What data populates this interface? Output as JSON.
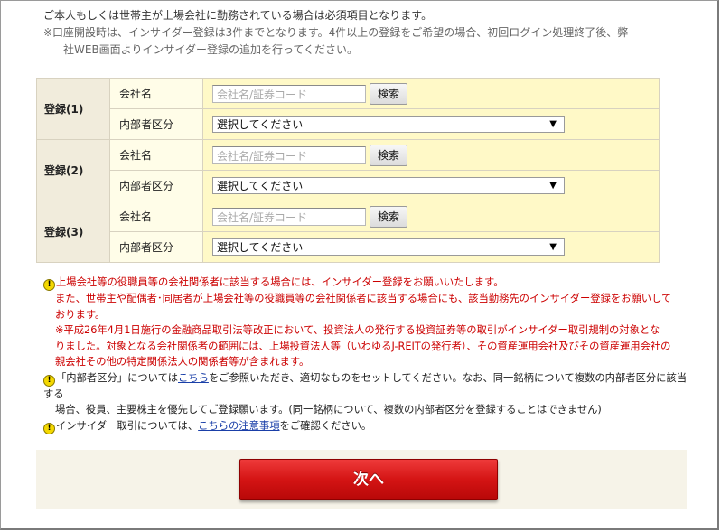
{
  "intro": {
    "line1": "ご本人もしくは世帯主が上場会社に勤務されている場合は必須項目となります。",
    "note_line1": "※口座開設時は、インサイダー登録は3件までとなります。4件以上の登録をご希望の場合、初回ログイン処理終了後、弊",
    "note_line2": "社WEB画面よりインサイダー登録の追加を行ってください。"
  },
  "registrations": [
    {
      "group_label": "登録(1)",
      "company_label": "会社名",
      "company_placeholder": "会社名/証券コード",
      "search_label": "検索",
      "category_label": "内部者区分",
      "category_value": "選択してください"
    },
    {
      "group_label": "登録(2)",
      "company_label": "会社名",
      "company_placeholder": "会社名/証券コード",
      "search_label": "検索",
      "category_label": "内部者区分",
      "category_value": "選択してください"
    },
    {
      "group_label": "登録(3)",
      "company_label": "会社名",
      "company_placeholder": "会社名/証券コード",
      "search_label": "検索",
      "category_label": "内部者区分",
      "category_value": "選択してください"
    }
  ],
  "notes": {
    "note1_line1": "上場会社等の役職員等の会社関係者に該当する場合には、インサイダー登録をお願いいたします。",
    "note1_line2": "また、世帯主や配偶者･同居者が上場会社等の役職員等の会社関係者に該当する場合にも、該当勤務先のインサイダー登録をお願いして",
    "note1_line3": "おります。",
    "note1_line4": "※平成26年4月1日施行の金融商品取引法等改正において、投資法人の発行する投資証券等の取引がインサイダー取引規制の対象とな",
    "note1_line5": "りました。対象となる会社関係者の範囲には、上場投資法人等（いわゆるJ-REITの発行者）、その資産運用会社及びその資産運用会社の",
    "note1_line6": "親会社その他の特定関係法人の関係者等が含まれます。",
    "note2_pre": "「内部者区分」については",
    "note2_link": "こちら",
    "note2_post": "をご参照いただき、適切なものをセットしてください。なお、同一銘柄について複数の内部者区分に該当する",
    "note2_line2": "場合、役員、主要株主を優先してご登録願います。(同一銘柄について、複数の内部者区分を登録することはできません)",
    "note3_pre": "インサイダー取引については、",
    "note3_link": "こちらの注意事項",
    "note3_post": "をご確認ください。"
  },
  "footer": {
    "next_label": "次へ"
  },
  "colors": {
    "accent_red": "#d41414",
    "note_red": "#cc0000",
    "link_blue": "#1a3fa8",
    "field_yellow": "#fff9c7"
  },
  "icons": {
    "note_icon": "exclamation-circle-icon",
    "dropdown_icon": "triangle-down-icon"
  }
}
